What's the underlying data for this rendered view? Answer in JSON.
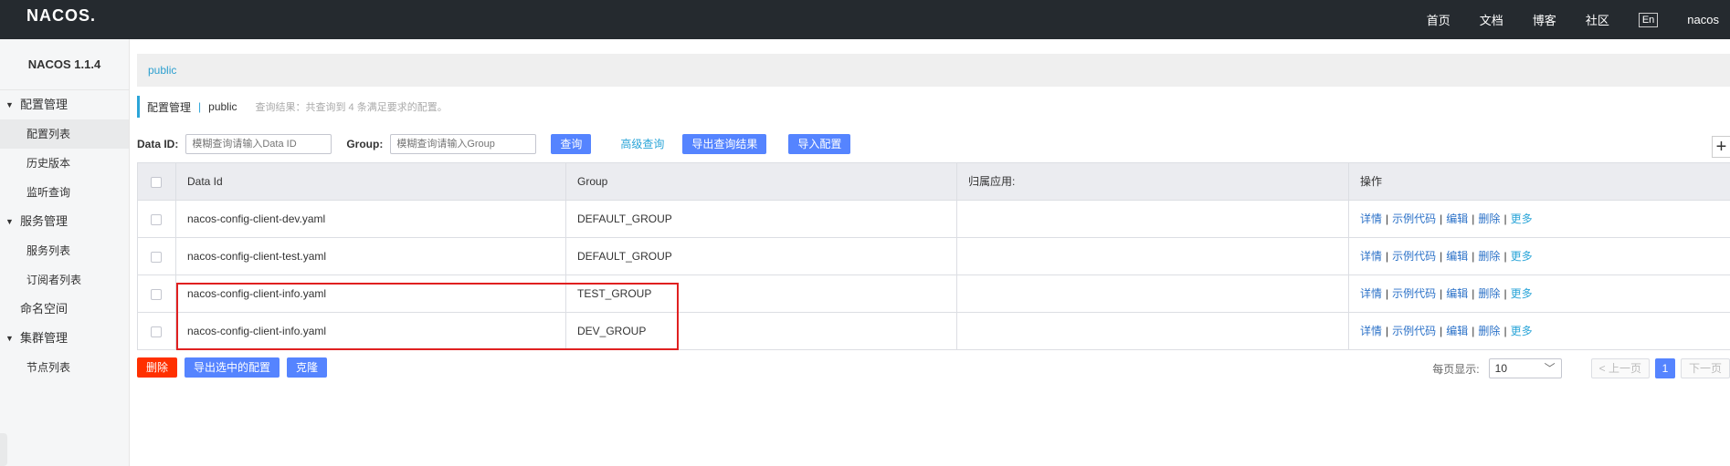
{
  "header": {
    "logo": "NACOS.",
    "nav": [
      "首页",
      "文档",
      "博客",
      "社区"
    ],
    "lang": "En",
    "user": "nacos"
  },
  "sidebar": {
    "version": "NACOS 1.1.4",
    "config_group": "配置管理",
    "config_items": [
      "配置列表",
      "历史版本",
      "监听查询"
    ],
    "service_group": "服务管理",
    "service_items": [
      "服务列表",
      "订阅者列表"
    ],
    "namespace": "命名空间",
    "cluster_group": "集群管理",
    "cluster_items": [
      "节点列表"
    ]
  },
  "namespace_bar": {
    "current": "public"
  },
  "title": {
    "main": "配置管理",
    "sep": "|",
    "ns": "public",
    "hint": "查询结果：共查询到 4 条满足要求的配置。"
  },
  "search": {
    "dataid_label": "Data ID:",
    "dataid_placeholder": "模糊查询请输入Data ID",
    "group_label": "Group:",
    "group_placeholder": "模糊查询请输入Group",
    "query_btn": "查询",
    "advanced": "高级查询",
    "export_btn": "导出查询结果",
    "import_btn": "导入配置"
  },
  "table": {
    "headers": [
      "Data Id",
      "Group",
      "归属应用:",
      "操作"
    ],
    "rows": [
      {
        "data_id": "nacos-config-client-dev.yaml",
        "group": "DEFAULT_GROUP",
        "app": ""
      },
      {
        "data_id": "nacos-config-client-test.yaml",
        "group": "DEFAULT_GROUP",
        "app": ""
      },
      {
        "data_id": "nacos-config-client-info.yaml",
        "group": "TEST_GROUP",
        "app": ""
      },
      {
        "data_id": "nacos-config-client-info.yaml",
        "group": "DEV_GROUP",
        "app": ""
      }
    ],
    "ops": [
      "详情",
      "示例代码",
      "编辑",
      "删除",
      "更多"
    ]
  },
  "bottom": {
    "delete_btn": "删除",
    "export_selected_btn": "导出选中的配置",
    "clone_btn": "克隆",
    "page_size_label": "每页显示:",
    "page_size": "10",
    "prev": "< 上一页",
    "page": "1",
    "next": "下一页"
  },
  "colors": {
    "topbar": "#252a2f",
    "primary": "#5584ff",
    "danger": "#ff3000",
    "highlight": "#e02020"
  }
}
